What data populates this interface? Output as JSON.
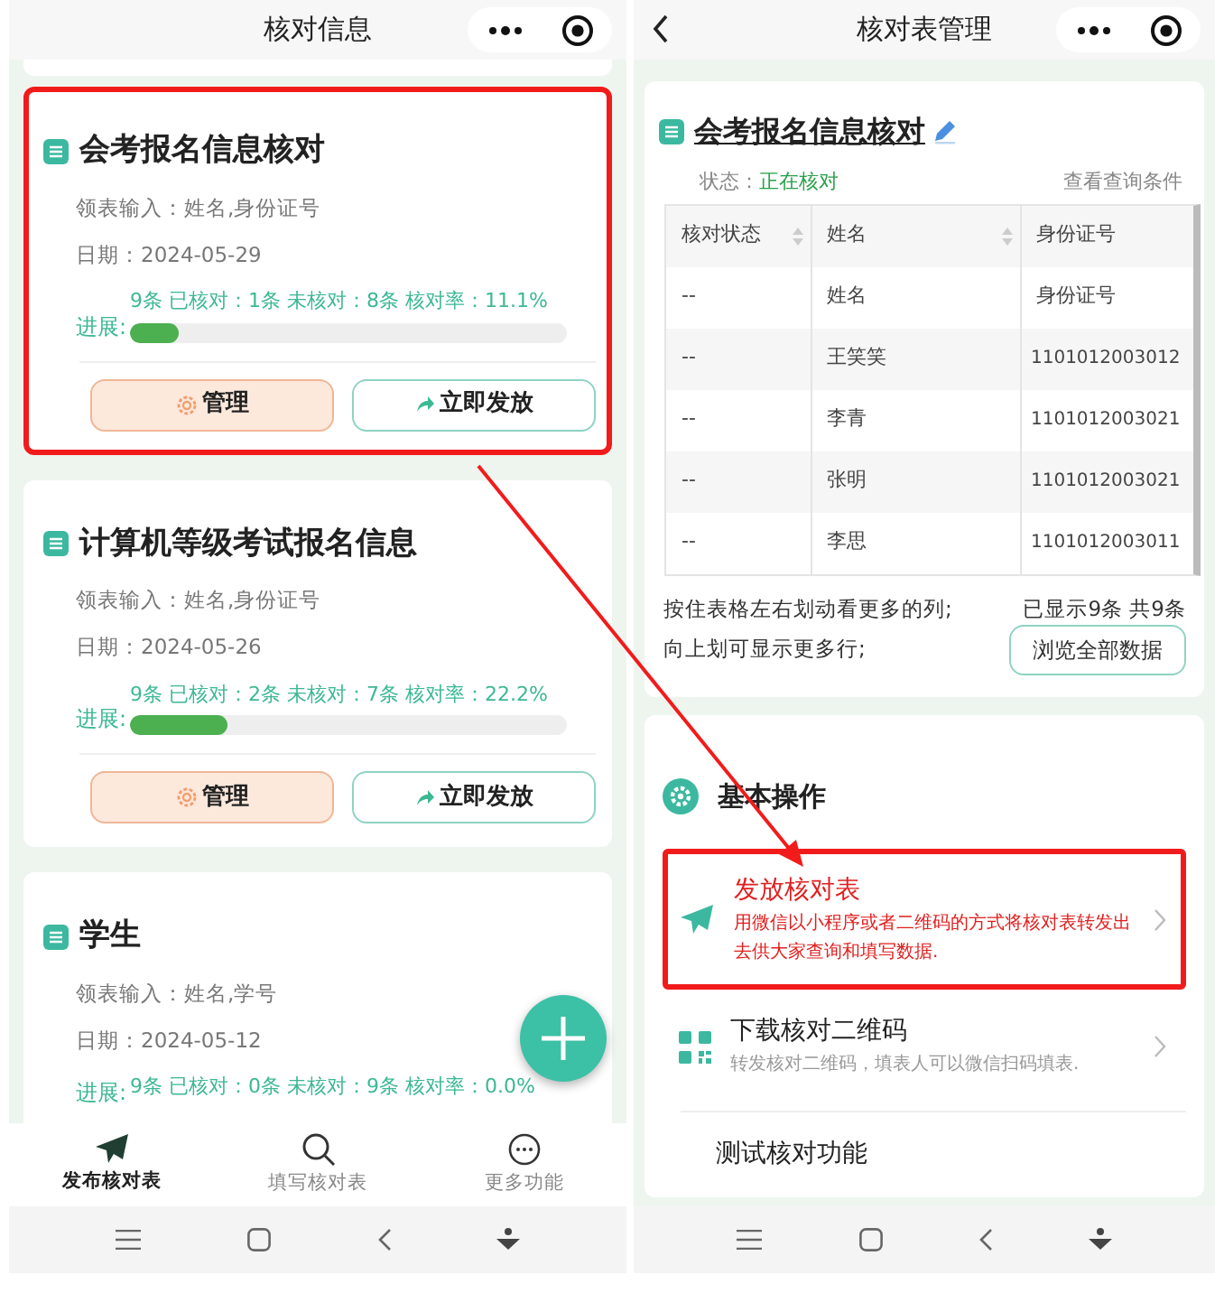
{
  "left": {
    "header": {
      "title": "核对信息"
    },
    "cards": [
      {
        "title": "会考报名信息核对",
        "fields": "领表输入：姓名,身份证号",
        "date": "日期：2024-05-29",
        "progress_label": "进展:",
        "progress_text": "9条 已核对：1条 未核对：8条 核对率：11.1%",
        "level": 0.111,
        "manage": "管理",
        "publish": "立即发放",
        "highlighted": true
      },
      {
        "title": "计算机等级考试报名信息",
        "fields": "领表输入：姓名,身份证号",
        "date": "日期：2024-05-26",
        "progress_label": "进展:",
        "progress_text": "9条 已核对：2条 未核对：7条 核对率：22.2%",
        "level": 0.222,
        "manage": "管理",
        "publish": "立即发放",
        "highlighted": false
      },
      {
        "title": "学生",
        "fields": "领表输入：姓名,学号",
        "date": "日期：2024-05-12",
        "progress_label": "进展:",
        "progress_text": "9条 已核对：0条 未核对：9条 核对率：0.0%",
        "highlighted": false
      }
    ],
    "tabs": [
      {
        "kind": "send",
        "label": "发布核对表",
        "selected": true
      },
      {
        "kind": "search",
        "label": "填写核对表",
        "selected": false
      },
      {
        "kind": "more",
        "label": "更多功能",
        "selected": false
      }
    ]
  },
  "right": {
    "header": {
      "title": "核对表管理"
    },
    "sheet": {
      "title": "会考报名信息核对",
      "status_label": "状态：",
      "status": "正在核对",
      "conditions_link": "查看查询条件",
      "table": {
        "columns": [
          {
            "label": "核对状态",
            "sortable": true
          },
          {
            "label": "姓名",
            "sortable": true
          },
          {
            "label": "身份证号",
            "sortable": false
          }
        ],
        "rows": [
          [
            "--",
            "姓名",
            "身份证号"
          ],
          [
            "--",
            "王笑笑",
            "1101012003012"
          ],
          [
            "--",
            "李青",
            "1101012003021"
          ],
          [
            "--",
            "张明",
            "1101012003021"
          ],
          [
            "--",
            "李思",
            "1101012003011"
          ]
        ]
      },
      "hint_1": "按住表格左右划动看更多的列;",
      "count": "已显示9条 共9条",
      "hint_2": "向上划可显示更多行;",
      "browse_button": "浏览全部数据"
    },
    "operations": {
      "title": "基本操作",
      "items": [
        {
          "kind": "send",
          "title": "发放核对表",
          "subtitle": "用微信以小程序或者二维码的方式将核对表转发出去供大家查询和填写数据.",
          "highlighted": true
        },
        {
          "kind": "qr",
          "title": "下载核对二维码",
          "subtitle": "转发核对二维码，填表人可以微信扫码填表.",
          "highlighted": false
        },
        {
          "kind": "plain",
          "title": "测试核对功能",
          "highlighted": false
        }
      ]
    }
  }
}
